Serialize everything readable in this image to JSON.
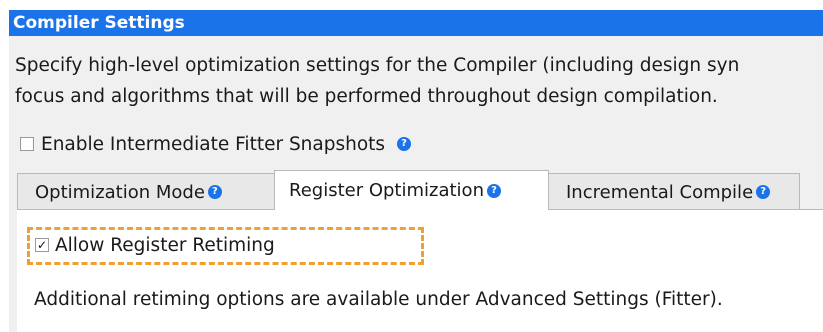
{
  "header": {
    "title": "Compiler Settings"
  },
  "description": {
    "line1": "Specify high-level optimization settings for the Compiler (including design syn",
    "line2": "focus and algorithms that will be performed throughout design compilation."
  },
  "snapshots": {
    "label": "Enable Intermediate Fitter Snapshots",
    "checked": false,
    "check_glyph": ""
  },
  "tabs": [
    {
      "label": "Optimization Mode",
      "active": false
    },
    {
      "label": "Register Optimization",
      "active": true
    },
    {
      "label": "Incremental Compile",
      "active": false
    }
  ],
  "register_optimization": {
    "retiming_label": "Allow Register Retiming",
    "retiming_checked": true,
    "check_glyph": "✓",
    "note": "Additional retiming options are available under Advanced Settings (Fitter)."
  },
  "icons": {
    "help_glyph": "?"
  },
  "colors": {
    "title_bar": "#1a73e8",
    "help_icon": "#1a73e8",
    "highlight": "#f0a030",
    "panel_background": "#f0f0f0"
  }
}
